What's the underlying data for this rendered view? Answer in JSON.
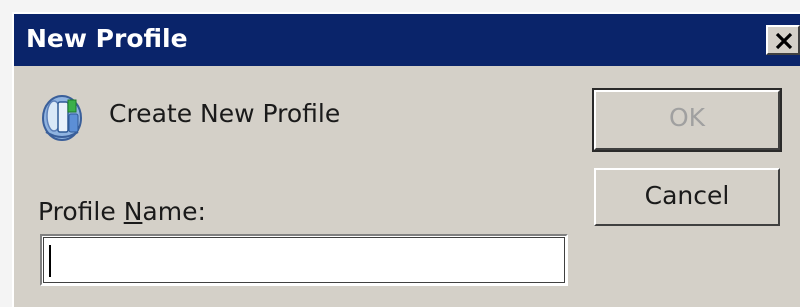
{
  "window": {
    "title": "New Profile",
    "close_icon": "close-icon"
  },
  "content": {
    "icon": "profile-icon",
    "heading": "Create New Profile",
    "name_label_prefix": "Profile ",
    "name_label_accel": "N",
    "name_label_suffix": "ame:",
    "name_value": "",
    "name_placeholder": ""
  },
  "buttons": {
    "ok_label": "OK",
    "ok_enabled": false,
    "cancel_label": "Cancel"
  },
  "colors": {
    "titlebar": "#0a246a",
    "dialog_face": "#d4d0c8",
    "disabled_text": "#a0a0a0"
  }
}
